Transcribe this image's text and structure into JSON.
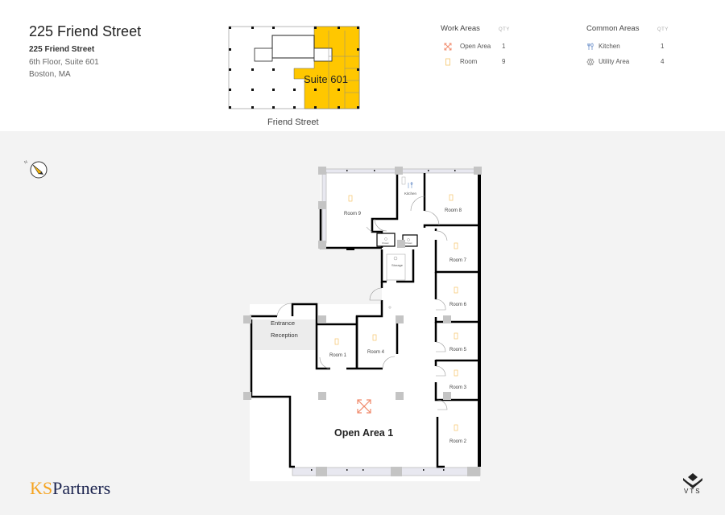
{
  "header": {
    "title": "225 Friend Street",
    "address_line1": "225 Friend Street",
    "address_line2": "6th Floor, Suite 601",
    "address_line3": "Boston, MA"
  },
  "keyplan": {
    "suite_label": "Suite 601",
    "street_label": "Friend Street",
    "highlight_color": "#ffc700"
  },
  "legend": {
    "work_areas": {
      "title": "Work Areas",
      "qty_header": "QTY",
      "items": [
        {
          "icon": "open-area-icon",
          "label": "Open Area",
          "qty": "1",
          "color": "#f0896a"
        },
        {
          "icon": "room-icon",
          "label": "Room",
          "qty": "9",
          "color": "#f5c56a"
        }
      ]
    },
    "common_areas": {
      "title": "Common Areas",
      "qty_header": "QTY",
      "items": [
        {
          "icon": "kitchen-icon",
          "label": "Kitchen",
          "qty": "1",
          "color": "#6b8fc9"
        },
        {
          "icon": "utility-area-icon",
          "label": "Utility Area",
          "qty": "4",
          "color": "#888888"
        }
      ]
    }
  },
  "floorplan": {
    "rooms": {
      "room9": "Room 9",
      "room8": "Room 8",
      "room7": "Room 7",
      "room6": "Room 6",
      "room5": "Room 5",
      "room4": "Room 4",
      "room3": "Room 3",
      "room2": "Room 2",
      "room1": "Room 1",
      "kitchen": "Kitchen",
      "storage": "Storage",
      "closet": "Closet",
      "entrance": "Entrance",
      "reception": "Reception",
      "open_area": "Open Area 1"
    }
  },
  "branding": {
    "ks_prefix": "KS",
    "ks_suffix": "Partners",
    "vts": "VTS"
  }
}
